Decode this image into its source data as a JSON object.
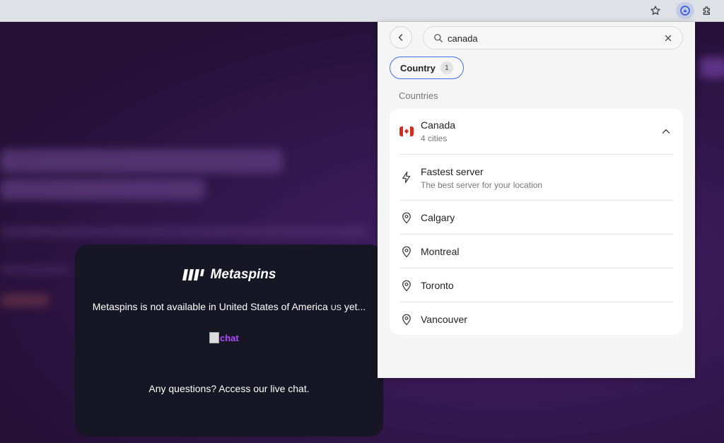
{
  "browser": {
    "icons": [
      "star-icon",
      "vpn-extension-icon",
      "extensions-puzzle-icon"
    ]
  },
  "site": {
    "logo_text": "Metaspins",
    "message_main": "Metaspins is not available in United States of America",
    "message_country_code": "US",
    "message_tail": "yet...",
    "chat_image_alt": "chat",
    "footer": "Any questions? Access our live chat."
  },
  "vpn": {
    "search": {
      "value": "canada",
      "placeholder": ""
    },
    "filter_chip": {
      "label": "Country",
      "count": "1"
    },
    "section_label": "Countries",
    "country": {
      "name": "Canada",
      "subtitle": "4 cities"
    },
    "fastest": {
      "title": "Fastest server",
      "subtitle": "The best server for your location"
    },
    "cities": [
      "Calgary",
      "Montreal",
      "Toronto",
      "Vancouver"
    ],
    "colors": {
      "accent": "#3b6ff0",
      "flag_red": "#d52b1e"
    }
  }
}
